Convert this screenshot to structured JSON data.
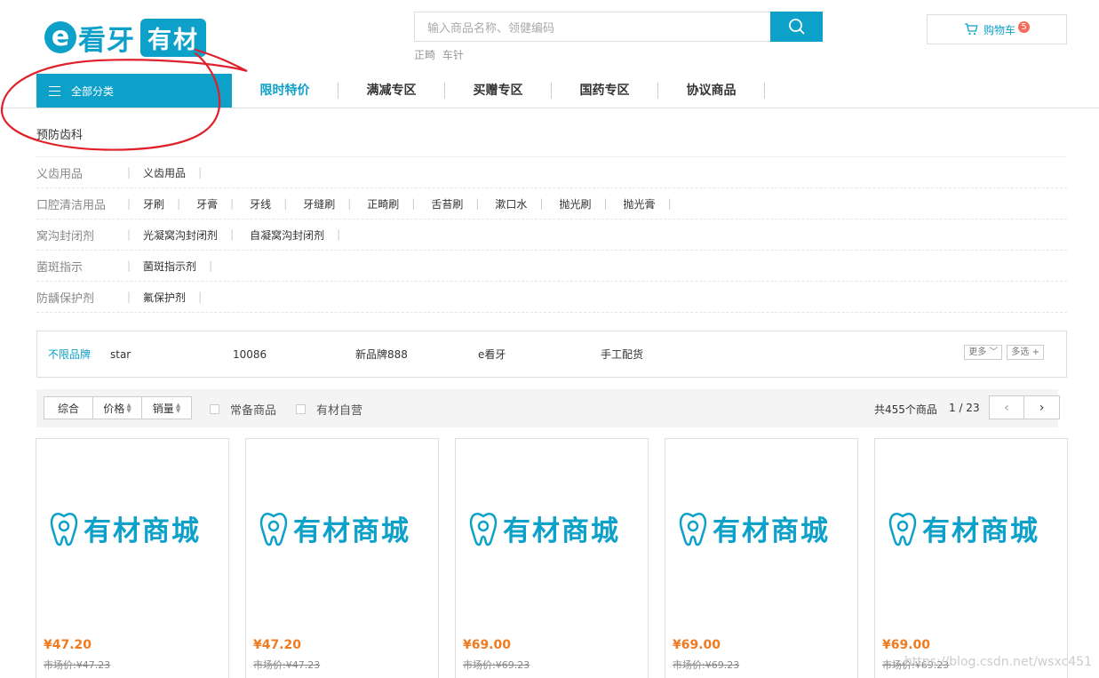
{
  "logo": {
    "e": "e",
    "kanya": "看牙",
    "youcai": "有材"
  },
  "search": {
    "placeholder": "输入商品名称、领健编码",
    "hot_words": [
      "正畸",
      "车针"
    ]
  },
  "cart": {
    "label": "购物车",
    "count": "5"
  },
  "nav": {
    "all_categories": "全部分类",
    "items": [
      {
        "label": "限时特价",
        "active": true
      },
      {
        "label": "满减专区"
      },
      {
        "label": "买赠专区"
      },
      {
        "label": "国药专区"
      },
      {
        "label": "协议商品"
      }
    ]
  },
  "category_title": "预防齿科",
  "filters": [
    {
      "name": "义齿用品",
      "options": [
        "义齿用品"
      ]
    },
    {
      "name": "口腔清洁用品",
      "options": [
        "牙刷",
        "牙膏",
        "牙线",
        "牙缝刷",
        "正畸刷",
        "舌苔刷",
        "漱口水",
        "抛光刷",
        "抛光膏"
      ]
    },
    {
      "name": "窝沟封闭剂",
      "options": [
        "光凝窝沟封闭剂",
        "自凝窝沟封闭剂"
      ]
    },
    {
      "name": "菌斑指示",
      "options": [
        "菌斑指示剂"
      ]
    },
    {
      "name": "防龋保护剂",
      "options": [
        "氟保护剂"
      ]
    }
  ],
  "brands": {
    "label": "不限品牌",
    "items": [
      "star",
      "10086",
      "新品牌888",
      "e看牙",
      "手工配货"
    ],
    "more": "更多",
    "multi": "多选"
  },
  "sort": {
    "buttons": [
      "综合",
      "价格",
      "销量"
    ],
    "checkboxes": [
      "常备商品",
      "有材自营"
    ],
    "total": "共455个商品",
    "page": "1 / 23",
    "prev": "‹",
    "next": "›"
  },
  "products": [
    {
      "image_text": "有材商城",
      "price": "¥47.20",
      "market_price": "市场价:¥47.23"
    },
    {
      "image_text": "有材商城",
      "price": "¥47.20",
      "market_price": "市场价:¥47.23"
    },
    {
      "image_text": "有材商城",
      "price": "¥69.00",
      "market_price": "市场价:¥69.23"
    },
    {
      "image_text": "有材商城",
      "price": "¥69.00",
      "market_price": "市场价:¥69.23"
    },
    {
      "image_text": "有材商城",
      "price": "¥69.00",
      "market_price": "市场价:¥69.23"
    }
  ],
  "watermark": "https://blog.csdn.net/wsxc451",
  "colors": {
    "brand": "#0da0c9",
    "price": "#f07a20",
    "badge": "#f86b5b",
    "annotation": "#e0202a"
  }
}
